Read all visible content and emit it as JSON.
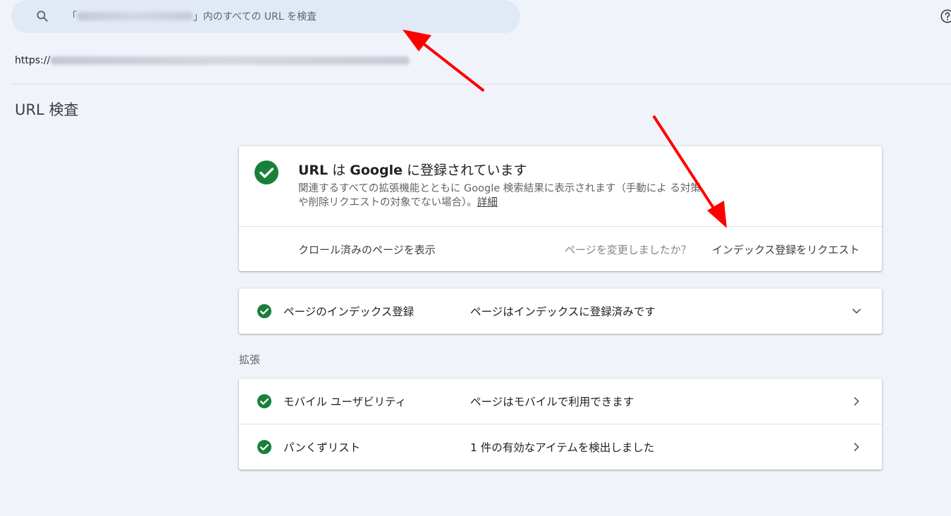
{
  "search": {
    "open_quote": "「",
    "suffix": "」内のすべての URL を検査"
  },
  "inspected_url_prefix": "https://",
  "page_title": "URL 検査",
  "status_card": {
    "title_part1": "URL",
    "title_part2": " は ",
    "title_part3": "Google",
    "title_part4": " に登録されています",
    "description": "関連するすべての拡張機能とともに Google 検索結果に表示されます（手動によ る対策や削除リクエストの対象でない場合）。",
    "details_link": "詳細",
    "view_crawled_label": "クロール済みのページを表示",
    "changed_question": "ページを変更しましたか？",
    "request_index_label": "インデックス登録をリクエスト"
  },
  "indexing": {
    "label": "ページのインデックス登録",
    "status": "ページはインデックスに登録済みです"
  },
  "enhancements": {
    "section_label": "拡張",
    "items": [
      {
        "label": "モバイル ユーザビリティ",
        "status": "ページはモバイルで利用できます"
      },
      {
        "label": "パンくずリスト",
        "status": "1 件の有効なアイテムを検出しました"
      }
    ]
  },
  "colors": {
    "success_green": "#188038",
    "annotation_red": "#ff0000"
  }
}
